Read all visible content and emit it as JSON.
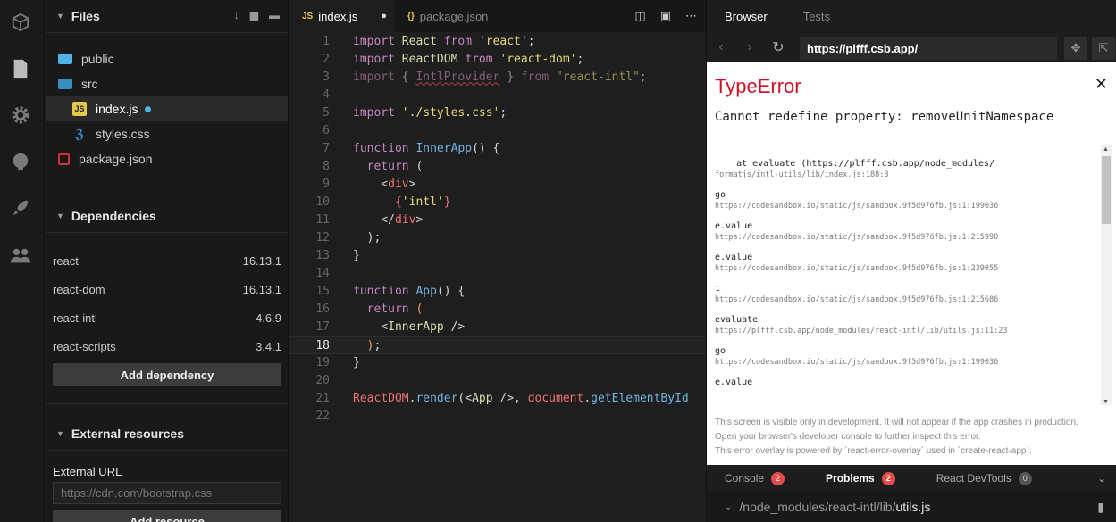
{
  "activity": {
    "icons": [
      "box-icon",
      "file-icon",
      "gear-icon",
      "github-icon",
      "rocket-icon",
      "users-icon"
    ]
  },
  "files": {
    "title": "Files",
    "items": [
      {
        "name": "public",
        "type": "folder"
      },
      {
        "name": "src",
        "type": "folder-open"
      },
      {
        "name": "index.js",
        "type": "js",
        "active": true
      },
      {
        "name": "styles.css",
        "type": "css"
      },
      {
        "name": "package.json",
        "type": "package"
      }
    ]
  },
  "dependencies": {
    "title": "Dependencies",
    "items": [
      {
        "name": "react",
        "version": "16.13.1"
      },
      {
        "name": "react-dom",
        "version": "16.13.1"
      },
      {
        "name": "react-intl",
        "version": "4.6.9"
      },
      {
        "name": "react-scripts",
        "version": "3.4.1"
      }
    ],
    "add_label": "Add dependency"
  },
  "external": {
    "title": "External resources",
    "url_label": "External URL",
    "url_placeholder": "https://cdn.com/bootstrap.css",
    "add_label": "Add resource"
  },
  "editor": {
    "tabs": [
      {
        "tag": "JS",
        "label": "index.js"
      },
      {
        "tag": "{}",
        "label": "package.json"
      }
    ],
    "line_numbers": [
      "1",
      "2",
      "3",
      "4",
      "5",
      "6",
      "7",
      "8",
      "9",
      "10",
      "11",
      "12",
      "13",
      "14",
      "15",
      "16",
      "17",
      "18",
      "19",
      "20",
      "21",
      "22"
    ]
  },
  "preview": {
    "tabs": [
      "Browser",
      "Tests"
    ],
    "url": "https://plfff.csb.app/",
    "error_title": "TypeError",
    "error_message": "Cannot redefine property: removeUnitNamespace",
    "stack": [
      {
        "fn": "    at evaluate (https://plfff.csb.app/node_modules/",
        "loc": "formatjs/intl-utils/lib/index.js:188:8"
      },
      {
        "fn": "go",
        "loc": "https://codesandbox.io/static/js/sandbox.9f5d976fb.js:1:199036"
      },
      {
        "fn": "e.value",
        "loc": "https://codesandbox.io/static/js/sandbox.9f5d976fb.js:1:215990"
      },
      {
        "fn": "e.value",
        "loc": "https://codesandbox.io/static/js/sandbox.9f5d976fb.js:1:239055"
      },
      {
        "fn": "t",
        "loc": "https://codesandbox.io/static/js/sandbox.9f5d976fb.js:1:215686"
      },
      {
        "fn": "evaluate",
        "loc": "https://plfff.csb.app/node_modules/react-intl/lib/utils.js:11:23"
      },
      {
        "fn": "go",
        "loc": "https://codesandbox.io/static/js/sandbox.9f5d976fb.js:1:199036"
      },
      {
        "fn": "e.value",
        "loc": ""
      }
    ],
    "footer": [
      "This screen is visible only in development. It will not appear if the app crashes in production.",
      "Open your browser's developer console to further inspect this error.",
      "This error overlay is powered by `react-error-overlay` used in `create-react-app`."
    ],
    "bottom_tabs": [
      {
        "label": "Console",
        "count": "2"
      },
      {
        "label": "Problems",
        "count": "2"
      },
      {
        "label": "React DevTools",
        "count": "0"
      }
    ],
    "problem_path_prefix": "/node_modules/react-intl/lib/",
    "problem_path_file": "utils.js"
  }
}
